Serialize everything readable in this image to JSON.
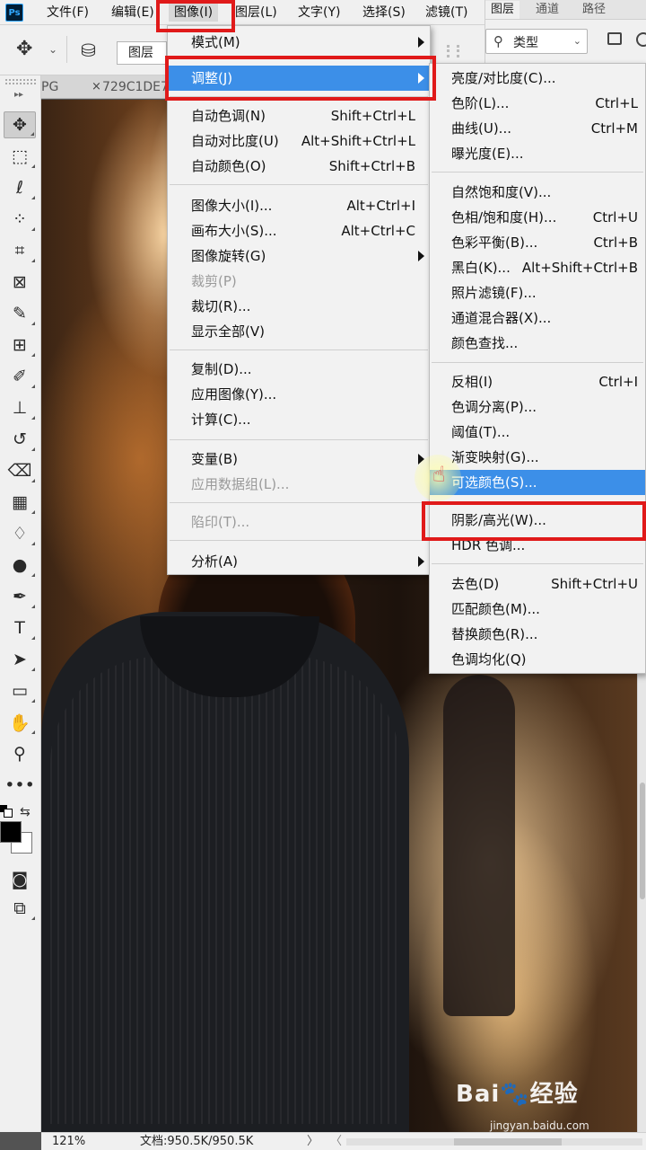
{
  "menubar": {
    "logo": "Ps",
    "items": [
      "文件(F)",
      "编辑(E)",
      "图像(I)",
      "图层(L)",
      "文字(Y)",
      "选择(S)",
      "滤镜(T)"
    ]
  },
  "options": {
    "layer_select": "图层"
  },
  "panel": {
    "tabs": [
      "图层",
      "通道",
      "路径"
    ],
    "filter": "类型"
  },
  "doc_tabs": {
    "tab1": "PG",
    "tab1_close": "×",
    "tab2": "729C1DE7"
  },
  "image_menu": {
    "items": [
      {
        "label": "模式(M)",
        "shortcut": "",
        "submenu": true
      },
      {
        "label": "调整(J)",
        "shortcut": "",
        "submenu": true,
        "highlight": true
      },
      {
        "label": "自动色调(N)",
        "shortcut": "Shift+Ctrl+L"
      },
      {
        "label": "自动对比度(U)",
        "shortcut": "Alt+Shift+Ctrl+L"
      },
      {
        "label": "自动颜色(O)",
        "shortcut": "Shift+Ctrl+B"
      },
      {
        "label": "图像大小(I)...",
        "shortcut": "Alt+Ctrl+I"
      },
      {
        "label": "画布大小(S)...",
        "shortcut": "Alt+Ctrl+C"
      },
      {
        "label": "图像旋转(G)",
        "shortcut": "",
        "submenu": true
      },
      {
        "label": "裁剪(P)",
        "shortcut": "",
        "disabled": true
      },
      {
        "label": "裁切(R)...",
        "shortcut": ""
      },
      {
        "label": "显示全部(V)",
        "shortcut": ""
      },
      {
        "label": "复制(D)...",
        "shortcut": ""
      },
      {
        "label": "应用图像(Y)...",
        "shortcut": ""
      },
      {
        "label": "计算(C)...",
        "shortcut": ""
      },
      {
        "label": "变量(B)",
        "shortcut": "",
        "submenu": true
      },
      {
        "label": "应用数据组(L)...",
        "shortcut": "",
        "disabled": true
      },
      {
        "label": "陷印(T)...",
        "shortcut": "",
        "disabled": true
      },
      {
        "label": "分析(A)",
        "shortcut": "",
        "submenu": true
      }
    ]
  },
  "adjust_menu": {
    "items": [
      {
        "label": "亮度/对比度(C)...",
        "shortcut": ""
      },
      {
        "label": "色阶(L)...",
        "shortcut": "Ctrl+L"
      },
      {
        "label": "曲线(U)...",
        "shortcut": "Ctrl+M"
      },
      {
        "label": "曝光度(E)...",
        "shortcut": ""
      },
      {
        "label": "自然饱和度(V)...",
        "shortcut": ""
      },
      {
        "label": "色相/饱和度(H)...",
        "shortcut": "Ctrl+U"
      },
      {
        "label": "色彩平衡(B)...",
        "shortcut": "Ctrl+B"
      },
      {
        "label": "黑白(K)...",
        "shortcut": "Alt+Shift+Ctrl+B"
      },
      {
        "label": "照片滤镜(F)...",
        "shortcut": ""
      },
      {
        "label": "通道混合器(X)...",
        "shortcut": ""
      },
      {
        "label": "颜色查找...",
        "shortcut": ""
      },
      {
        "label": "反相(I)",
        "shortcut": "Ctrl+I"
      },
      {
        "label": "色调分离(P)...",
        "shortcut": ""
      },
      {
        "label": "阈值(T)...",
        "shortcut": ""
      },
      {
        "label": "渐变映射(G)...",
        "shortcut": ""
      },
      {
        "label": "可选颜色(S)...",
        "shortcut": "",
        "highlight": true
      },
      {
        "label": "阴影/高光(W)...",
        "shortcut": ""
      },
      {
        "label": "HDR 色调...",
        "shortcut": ""
      },
      {
        "label": "去色(D)",
        "shortcut": "Shift+Ctrl+U"
      },
      {
        "label": "匹配颜色(M)...",
        "shortcut": ""
      },
      {
        "label": "替换颜色(R)...",
        "shortcut": ""
      },
      {
        "label": "色调均化(Q)",
        "shortcut": ""
      }
    ]
  },
  "status": {
    "zoom": "121%",
    "doc_size": "文档:950.5K/950.5K",
    "arrow": "〉",
    "left_arrow": "〈"
  },
  "watermark": {
    "logo": "Bai🐾经验",
    "url": "jingyan.baidu.com"
  },
  "colors": {
    "highlight": "#3c8fe8",
    "annotation": "#e01a1a",
    "foreground": "#000000",
    "background": "#ffffff"
  }
}
